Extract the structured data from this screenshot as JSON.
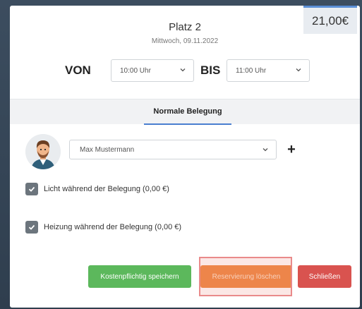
{
  "header": {
    "price": "21,00€",
    "title": "Platz 2",
    "subtitle": "Mittwoch, 09.11.2022"
  },
  "time": {
    "from_label": "VON",
    "from_value": "10:00 Uhr",
    "to_label": "BIS",
    "to_value": "11:00 Uhr"
  },
  "tabs": [
    {
      "label": "Normale Belegung",
      "active": true
    }
  ],
  "member": {
    "selected": "Max Mustermann",
    "add_label": "+"
  },
  "options": [
    {
      "label": "Licht während der Belegung (0,00 €)",
      "checked": true
    },
    {
      "label": "Heizung während der Belegung (0,00 €)",
      "checked": true
    }
  ],
  "buttons": {
    "save": "Kostenpflichtig speichern",
    "delete": "Reservierung löschen",
    "close": "Schließen"
  },
  "colors": {
    "save": "#5cb85c",
    "delete": "#ec7d30",
    "close": "#d9534f",
    "tab_accent": "#4a7fd0"
  }
}
